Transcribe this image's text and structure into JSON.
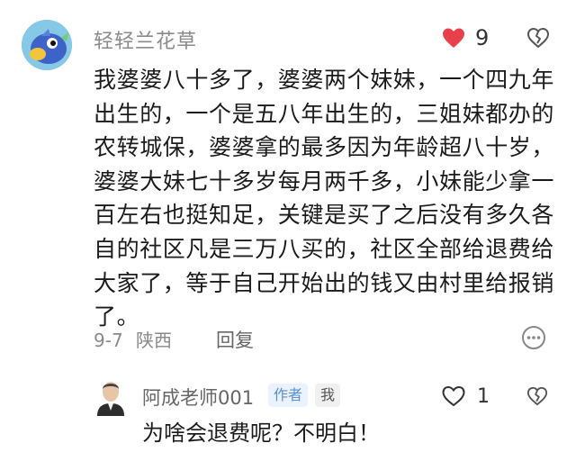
{
  "comment": {
    "username": "轻轻兰花草",
    "like_count": "9",
    "body": "我婆婆八十多了，婆婆两个妹妹，一个四九年出生的，一个是五八年出生的，三姐妹都办的农转城保，婆婆拿的最多因为年龄超八十岁，婆婆大妹七十多岁每月两千多，小妹能少拿一百左右也挺知足，关键是买了之后没有多久各自的社区凡是三万八买的，社区全部给退费给大家了，等于自己开始出的钱又由村里给报销了。",
    "date": "9-7",
    "location": "陕西",
    "reply_label": "回复"
  },
  "reply": {
    "username": "阿成老师001",
    "author_badge": "作者",
    "me_badge": "我",
    "like_count": "1",
    "body": "为啥会退费呢？不明白！"
  },
  "colors": {
    "like_red": "#e8404b",
    "meta_gray": "#8a8a8a",
    "author_badge_blue": "#5b8fd0"
  },
  "icons": {
    "like": "heart-icon",
    "dislike": "broken-heart-icon",
    "more": "more-circle-icon"
  }
}
